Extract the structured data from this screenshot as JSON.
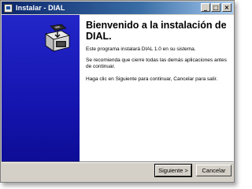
{
  "window": {
    "title": "Instalar - DIAL",
    "minimize_glyph": "_",
    "maximize_glyph": "□",
    "close_glyph": "×"
  },
  "content": {
    "heading": "Bienvenido a la instalación de DIAL.",
    "paragraph1": "Este programa instalará DIAL 1.0 en su sistema.",
    "paragraph2": "Se recomienda que cierre todas las demás aplicaciones antes de continuar.",
    "paragraph3": "Haga clic en Siguiente para continuar, Cancelar para salir."
  },
  "buttons": {
    "next_label": "Siguiente >",
    "cancel_label": "Cancelar"
  },
  "icons": {
    "app": "installer-app-icon",
    "banner": "computer-install-icon"
  },
  "colors": {
    "titlebar": "#0a246a",
    "banner": "#1a1dbf",
    "dialog": "#d4d0c8"
  }
}
